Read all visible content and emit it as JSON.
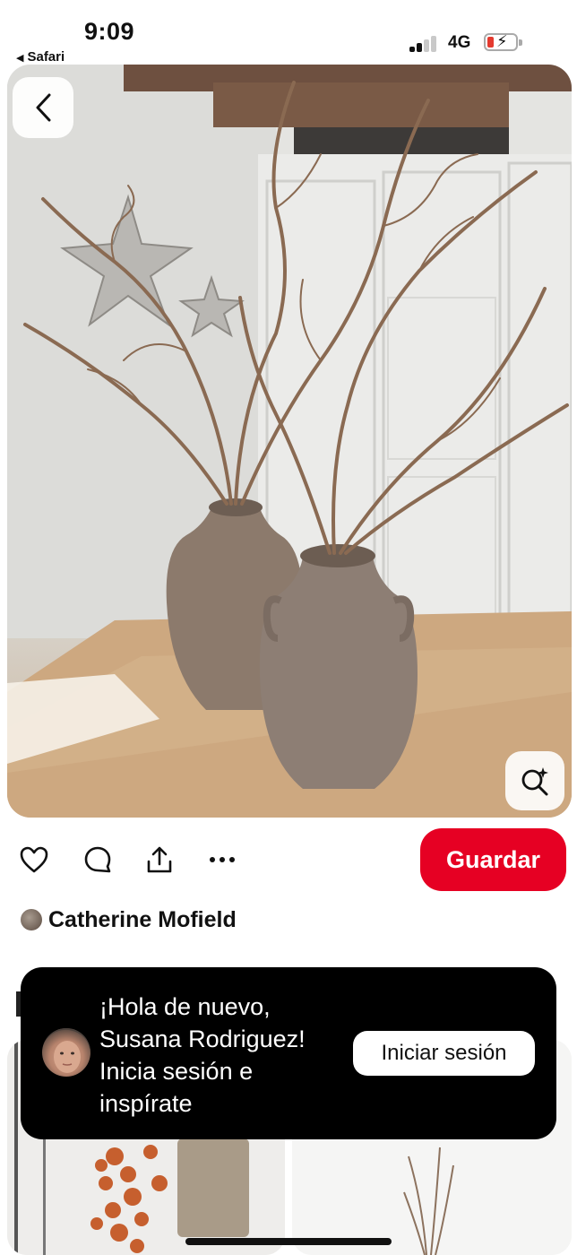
{
  "status_bar": {
    "time": "9:09",
    "back_app": "Safari",
    "network": "4G",
    "battery_level": 0.2,
    "battery_color": "#e43a2f"
  },
  "pin": {
    "image_subject": "curly willow branches in two rustic clay vases on wooden table",
    "back_icon": "chevron-left-icon",
    "lens_icon": "visual-search-icon"
  },
  "actions": {
    "like_icon": "heart-icon",
    "comment_icon": "comment-icon",
    "share_icon": "share-icon",
    "more_icon": "more-icon",
    "save_label": "Guardar",
    "save_color": "#e60023"
  },
  "creator": {
    "name": "Catherine Mofield"
  },
  "toast": {
    "line1": "¡Hola de nuevo,",
    "line2": "Susana Rodriguez!",
    "line3": "Inicia sesión e",
    "line4": "inspírate",
    "login_label": "Iniciar sesión"
  }
}
